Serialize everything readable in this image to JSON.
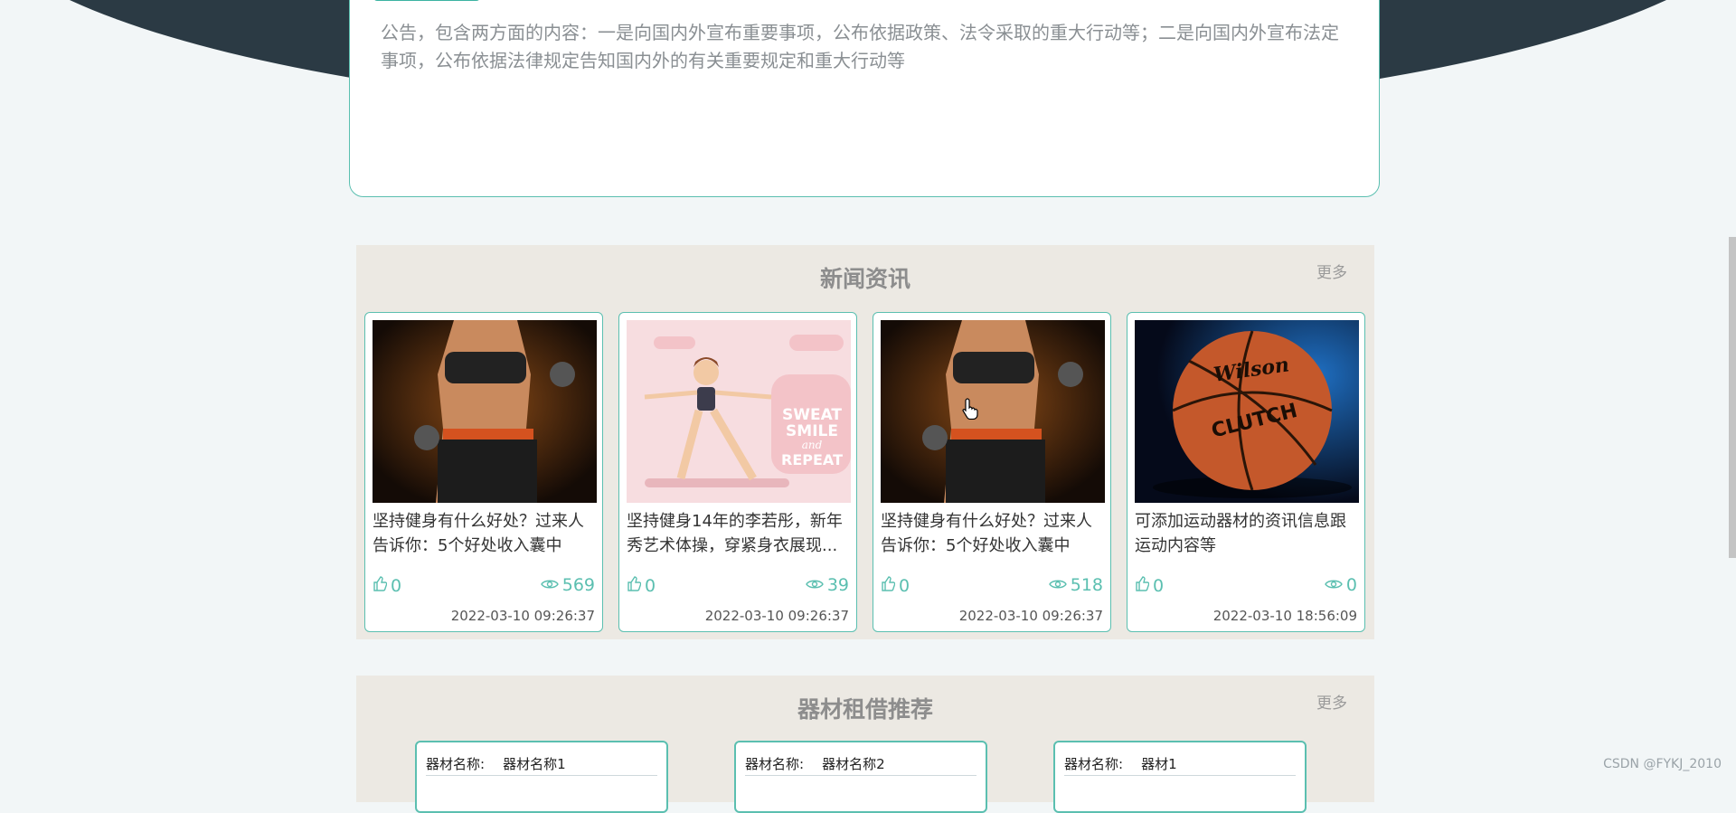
{
  "notice": {
    "body": "公告，包含两方面的内容：一是向国内外宣布重要事项，公布依据政策、法令采取的重大行动等；二是向国内外宣布法定事项，公布依据法律规定告知国内外的有关重要规定和重大行动等"
  },
  "news": {
    "title": "新闻资讯",
    "more": "更多",
    "items": [
      {
        "title": "坚持健身有什么好处？过来人告诉你：5个好处收入囊中",
        "likes": "0",
        "views": "569",
        "date": "2022-03-10 09:26:37",
        "image": "fitness-woman-dumbbells"
      },
      {
        "title": "坚持健身14年的李若彤，新年秀艺术体操，穿紧身衣展现...",
        "likes": "0",
        "views": "39",
        "date": "2022-03-10 09:26:37",
        "image": "sweat-smile-repeat-illustration"
      },
      {
        "title": "坚持健身有什么好处？过来人告诉你：5个好处收入囊中",
        "likes": "0",
        "views": "518",
        "date": "2022-03-10 09:26:37",
        "image": "fitness-woman-dumbbells"
      },
      {
        "title": "可添加运动器材的资讯信息跟运动内容等",
        "likes": "0",
        "views": "0",
        "date": "2022-03-10 18:56:09",
        "image": "basketball-clutch"
      }
    ]
  },
  "equipment": {
    "title": "器材租借推荐",
    "more": "更多",
    "items": [
      {
        "label": "器材名称:",
        "name": "器材名称1"
      },
      {
        "label": "器材名称:",
        "name": "器材名称2"
      },
      {
        "label": "器材名称:",
        "name": "器材1"
      }
    ]
  },
  "illustration_text": {
    "line1": "SWEAT",
    "line2": "SMILE",
    "line3": "and",
    "line4": "REPEAT"
  },
  "ball_text": {
    "brand": "Wilson",
    "model": "CLUTCH"
  },
  "watermark": "CSDN @FYKJ_2010",
  "colors": {
    "accent": "#5bbfb0",
    "hero": "#2b3a44",
    "section": "#ece9e3"
  },
  "icons": {
    "like": "thumbs-up-icon",
    "view": "eye-icon"
  }
}
